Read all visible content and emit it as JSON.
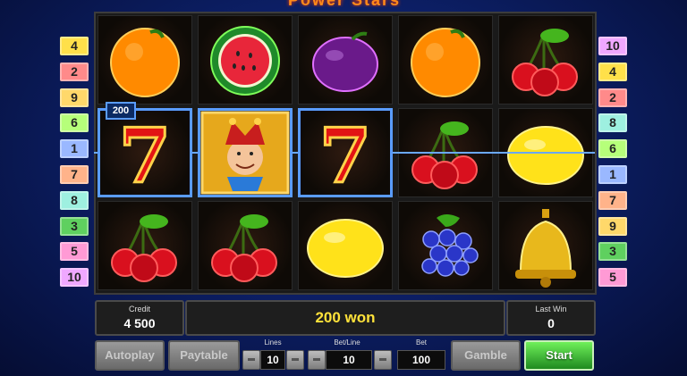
{
  "game": {
    "title": "Power Stars"
  },
  "left_lines": [
    "4",
    "2",
    "9",
    "6",
    "1",
    "7",
    "8",
    "3",
    "5",
    "10"
  ],
  "right_lines": [
    "10",
    "4",
    "2",
    "8",
    "6",
    "1",
    "7",
    "9",
    "3",
    "5"
  ],
  "line_colors": {
    "1": "#9ab8ff",
    "2": "#ff8a8a",
    "3": "#5fd05f",
    "4": "#ffe04a",
    "5": "#ff9ad5",
    "6": "#b6ff7a",
    "7": "#ffb38a",
    "8": "#9ef0e0",
    "9": "#ffd86a",
    "10": "#f0a8ff"
  },
  "reels": [
    [
      "orange",
      "seven",
      "cherries"
    ],
    [
      "watermelon",
      "joker",
      "cherries"
    ],
    [
      "plum",
      "seven",
      "lemon"
    ],
    [
      "orange",
      "cherries",
      "grapes"
    ],
    [
      "cherries",
      "lemon",
      "bell"
    ]
  ],
  "win_tag": "200",
  "status": {
    "credit_label": "Credit",
    "credit_value": "4 500",
    "message": "200 won",
    "last_win_label": "Last Win",
    "last_win_value": "0"
  },
  "controls": {
    "autoplay_label": "Autoplay",
    "paytable_label": "Paytable",
    "lines_label": "Lines",
    "lines_value": "10",
    "betline_label": "Bet/Line",
    "betline_value": "10",
    "bet_label": "Bet",
    "bet_value": "100",
    "gamble_label": "Gamble",
    "start_label": "Start"
  }
}
